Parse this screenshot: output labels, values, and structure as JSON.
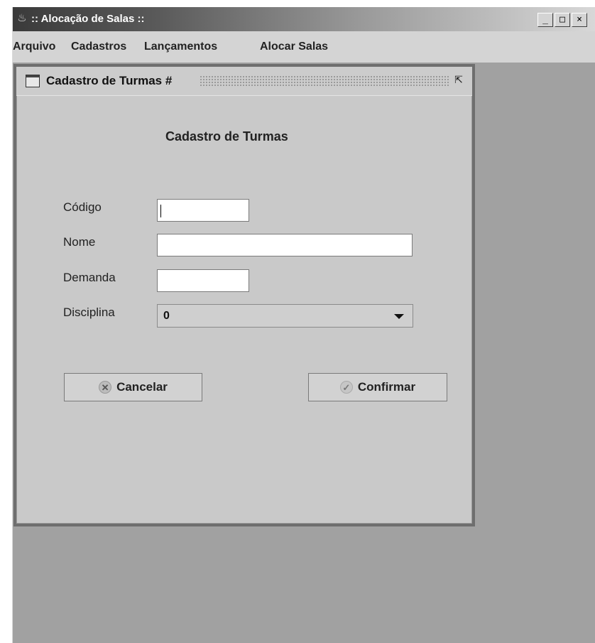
{
  "window": {
    "icon": "java-cup-icon",
    "title": ":: Alocação de Salas ::",
    "controls": {
      "minimize": "_",
      "maximize": "□",
      "close": "×"
    }
  },
  "menu": {
    "items": [
      "Arquivo",
      "Cadastros",
      "Lançamentos",
      "Alocar Salas"
    ]
  },
  "internal_frame": {
    "title": "Cadastro de Turmas #",
    "icon": "window-icon",
    "restore_icon": "restore-icon"
  },
  "form": {
    "heading": "Cadastro de Turmas",
    "fields": {
      "codigo": {
        "label": "Código",
        "value": ""
      },
      "nome": {
        "label": "Nome",
        "value": ""
      },
      "demanda": {
        "label": "Demanda",
        "value": ""
      },
      "disciplina": {
        "label": "Disciplina",
        "selected": "0"
      }
    },
    "buttons": {
      "cancel": {
        "label": "Cancelar",
        "icon": "cancel-icon"
      },
      "confirm": {
        "label": "Confirmar",
        "icon": "check-icon"
      }
    }
  }
}
